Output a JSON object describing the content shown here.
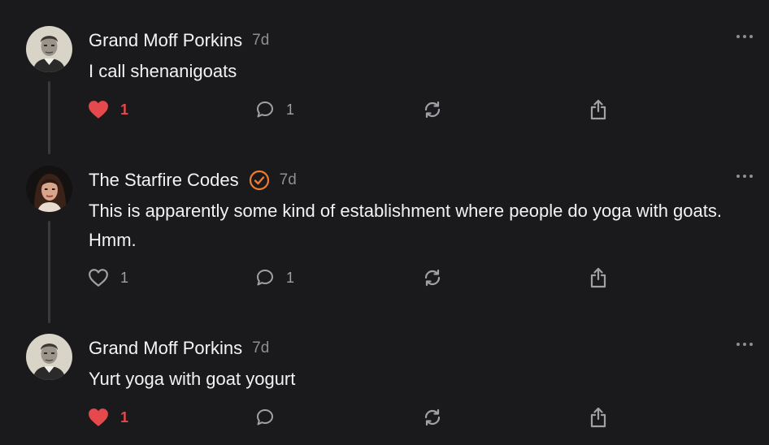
{
  "colors": {
    "background": "#1a1a1c",
    "liked": "#e5484d",
    "verified": "#f07b2c",
    "muted": "#8e8e93"
  },
  "posts": [
    {
      "author": "Grand Moff Porkins",
      "time": "7d",
      "verified": false,
      "text": "I call shenanigoats",
      "liked": true,
      "like_count": "1",
      "comment_count": "1"
    },
    {
      "author": "The Starfire Codes",
      "time": "7d",
      "verified": true,
      "text": "This is apparently some kind of establishment where people do yoga with goats. Hmm.",
      "liked": false,
      "like_count": "1",
      "comment_count": "1"
    },
    {
      "author": "Grand Moff Porkins",
      "time": "7d",
      "verified": false,
      "text": "Yurt yoga with goat yogurt",
      "liked": true,
      "like_count": "1",
      "comment_count": ""
    }
  ],
  "icons": {
    "like": "heart-icon",
    "comment": "comment-icon",
    "restack": "restack-icon",
    "share": "share-icon",
    "more": "more-icon",
    "verified": "verified-badge-icon"
  }
}
